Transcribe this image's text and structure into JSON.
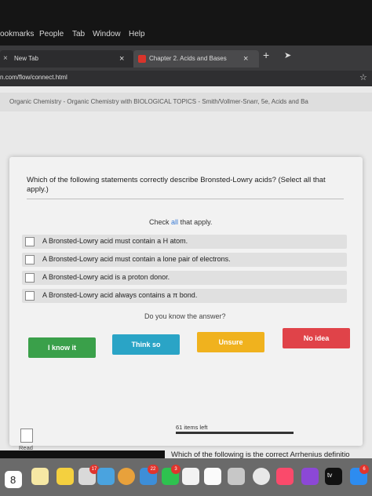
{
  "menubar": {
    "items": [
      "ookmarks",
      "People",
      "Tab",
      "Window",
      "Help"
    ]
  },
  "tabs": {
    "new_tab": "New Tab",
    "chapter_tab": "Chapter 2. Acids and Bases",
    "close_glyph": "×",
    "new_tab_glyph": "+"
  },
  "url": "n.com/flow/connect.html",
  "breadcrumb": "Organic Chemistry - Organic Chemistry with BIOLOGICAL TOPICS - Smith/Vollmer-Snarr, 5e, Acids and Ba",
  "question": {
    "prompt": "Which of the following statements correctly describe Bronsted-Lowry acids? (Select all that apply.)",
    "instruction_pre": "Check",
    "instruction_all": "all",
    "instruction_post": "that apply.",
    "options": [
      "A Bronsted-Lowry acid must contain a H atom.",
      "A Bronsted-Lowry acid must contain a lone pair of electrons.",
      "A Bronsted-Lowry acid is a proton donor.",
      "A Bronsted-Lowry acid always contains a π bond."
    ],
    "confidence_prompt": "Do you know the answer?",
    "buttons": {
      "know": "I know it",
      "think": "Think so",
      "unsure": "Unsure",
      "no_idea": "No idea"
    }
  },
  "progress": {
    "items_left": "61 items left"
  },
  "read": "Read",
  "next_preview": "Which of the following is the correct Arrhenius definitio",
  "dock": {
    "calendar_day": "8",
    "badge_17": "17",
    "badge_22": "22",
    "badge_3": "3",
    "tv_label": "tv",
    "badge_6": "6"
  },
  "colors": {
    "know": "#3aa04a",
    "think": "#2aa4c6",
    "unsure": "#f0b21e",
    "no_idea": "#e04349",
    "link": "#3a7bd5"
  }
}
